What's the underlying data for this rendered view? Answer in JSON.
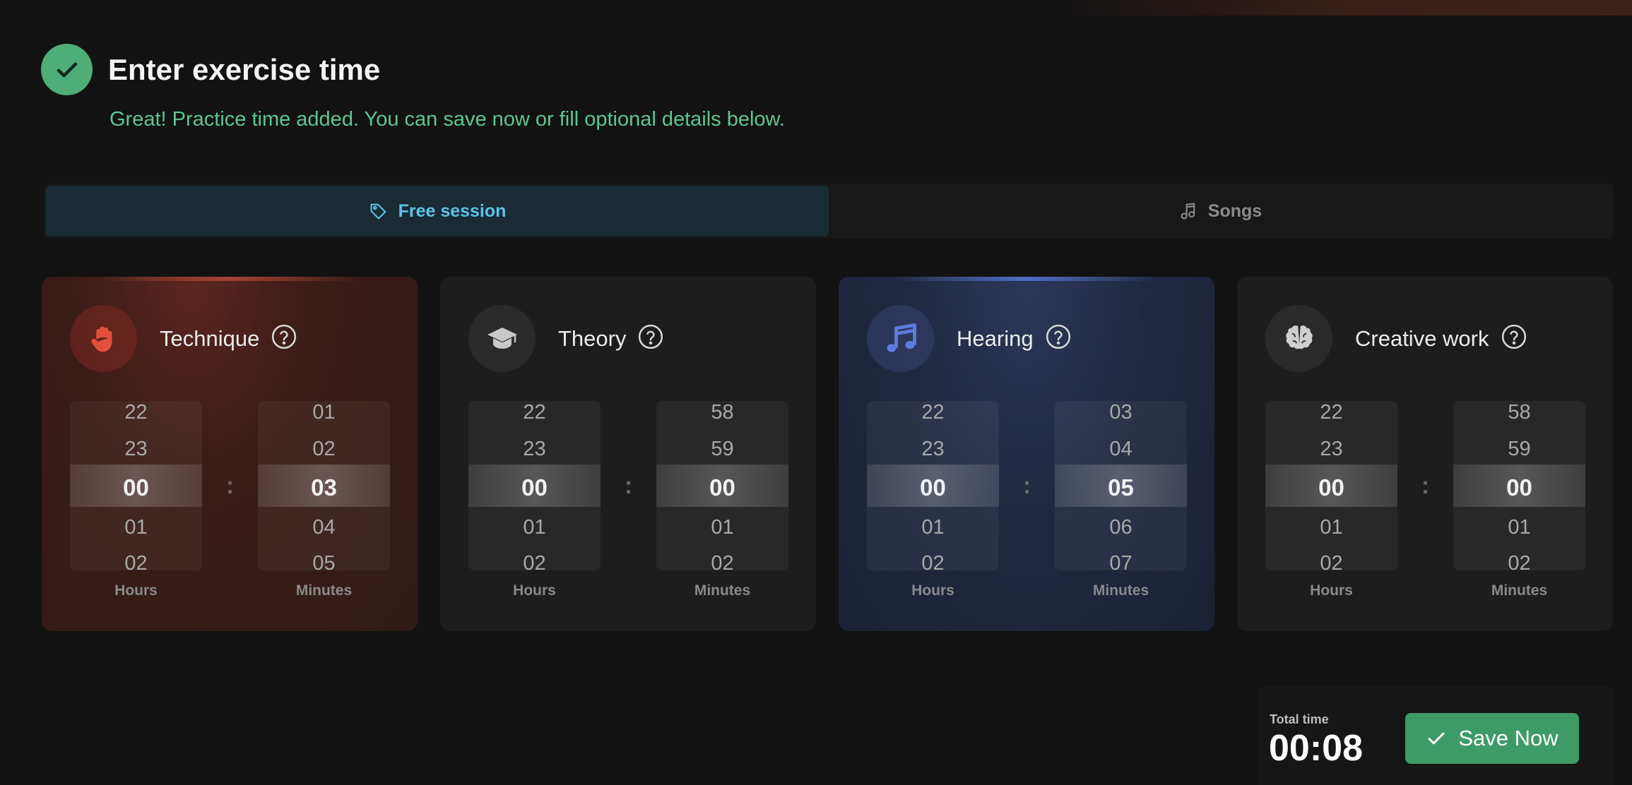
{
  "header": {
    "title": "Enter exercise time",
    "subtitle": "Great! Practice time added. You can save now or fill optional details below."
  },
  "tabs": [
    {
      "label": "Free session",
      "icon": "tag-icon",
      "active": true
    },
    {
      "label": "Songs",
      "icon": "music-note-icon",
      "active": false
    }
  ],
  "cards": [
    {
      "label": "Technique",
      "icon": "hand-icon",
      "hours": [
        "22",
        "23",
        "00",
        "01",
        "02"
      ],
      "minutes": [
        "01",
        "02",
        "03",
        "04",
        "05"
      ],
      "hours_label": "Hours",
      "minutes_label": "Minutes"
    },
    {
      "label": "Theory",
      "icon": "graduation-cap-icon",
      "hours": [
        "22",
        "23",
        "00",
        "01",
        "02"
      ],
      "minutes": [
        "58",
        "59",
        "00",
        "01",
        "02"
      ],
      "hours_label": "Hours",
      "minutes_label": "Minutes"
    },
    {
      "label": "Hearing",
      "icon": "music-notes-icon",
      "hours": [
        "22",
        "23",
        "00",
        "01",
        "02"
      ],
      "minutes": [
        "03",
        "04",
        "05",
        "06",
        "07"
      ],
      "hours_label": "Hours",
      "minutes_label": "Minutes"
    },
    {
      "label": "Creative work",
      "icon": "brain-icon",
      "hours": [
        "22",
        "23",
        "00",
        "01",
        "02"
      ],
      "minutes": [
        "58",
        "59",
        "00",
        "01",
        "02"
      ],
      "hours_label": "Hours",
      "minutes_label": "Minutes"
    }
  ],
  "colon": ":",
  "footer": {
    "total_label": "Total time",
    "total_value": "00:08",
    "save_label": "Save Now"
  },
  "colors": {
    "accent_green": "#4fae78",
    "tab_active_text": "#5dc2e8",
    "technique_icon": "#e0503a",
    "hearing_icon": "#5b7be0"
  }
}
